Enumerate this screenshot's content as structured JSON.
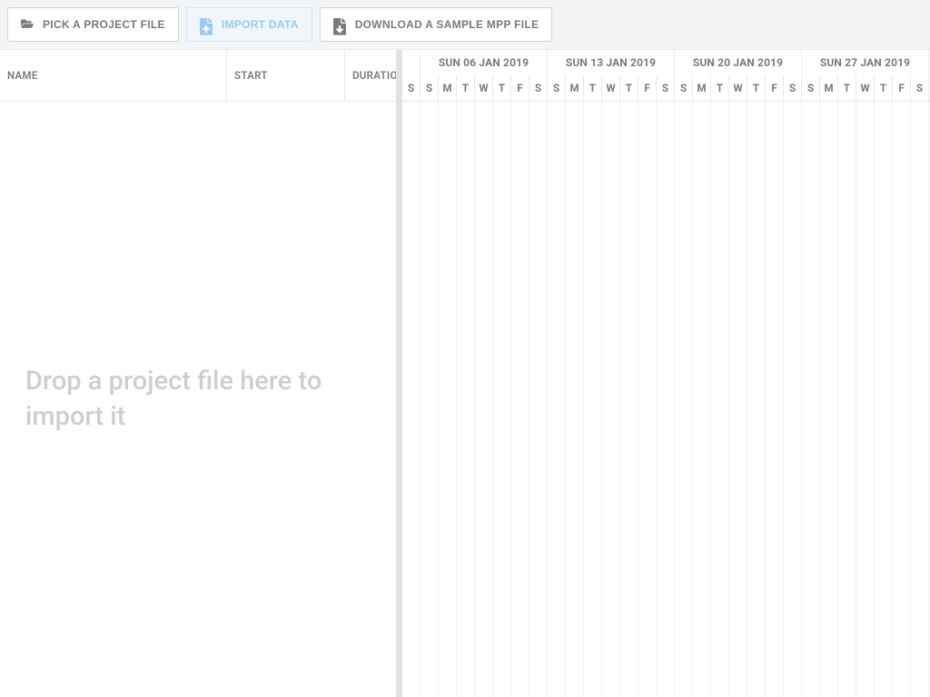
{
  "toolbar": {
    "pick_label": "PICK A PROJECT FILE",
    "import_label": "IMPORT DATA",
    "download_label": "DOWNLOAD A SAMPLE MPP FILE"
  },
  "grid": {
    "col_name": "NAME",
    "col_start": "START",
    "col_duration": "DURATION",
    "placeholder": "Drop a project file here to import it"
  },
  "timeline": {
    "weeks": [
      {
        "label": "",
        "is_partial": true
      },
      {
        "label": "SUN 06 JAN 2019"
      },
      {
        "label": "SUN 13 JAN 2019"
      },
      {
        "label": "SUN 20 JAN 2019"
      },
      {
        "label": "SUN 27 JAN 2019"
      }
    ],
    "day_labels": [
      "S",
      "M",
      "T",
      "W",
      "T",
      "F",
      "S"
    ],
    "partial_first_days": [
      "S"
    ]
  }
}
